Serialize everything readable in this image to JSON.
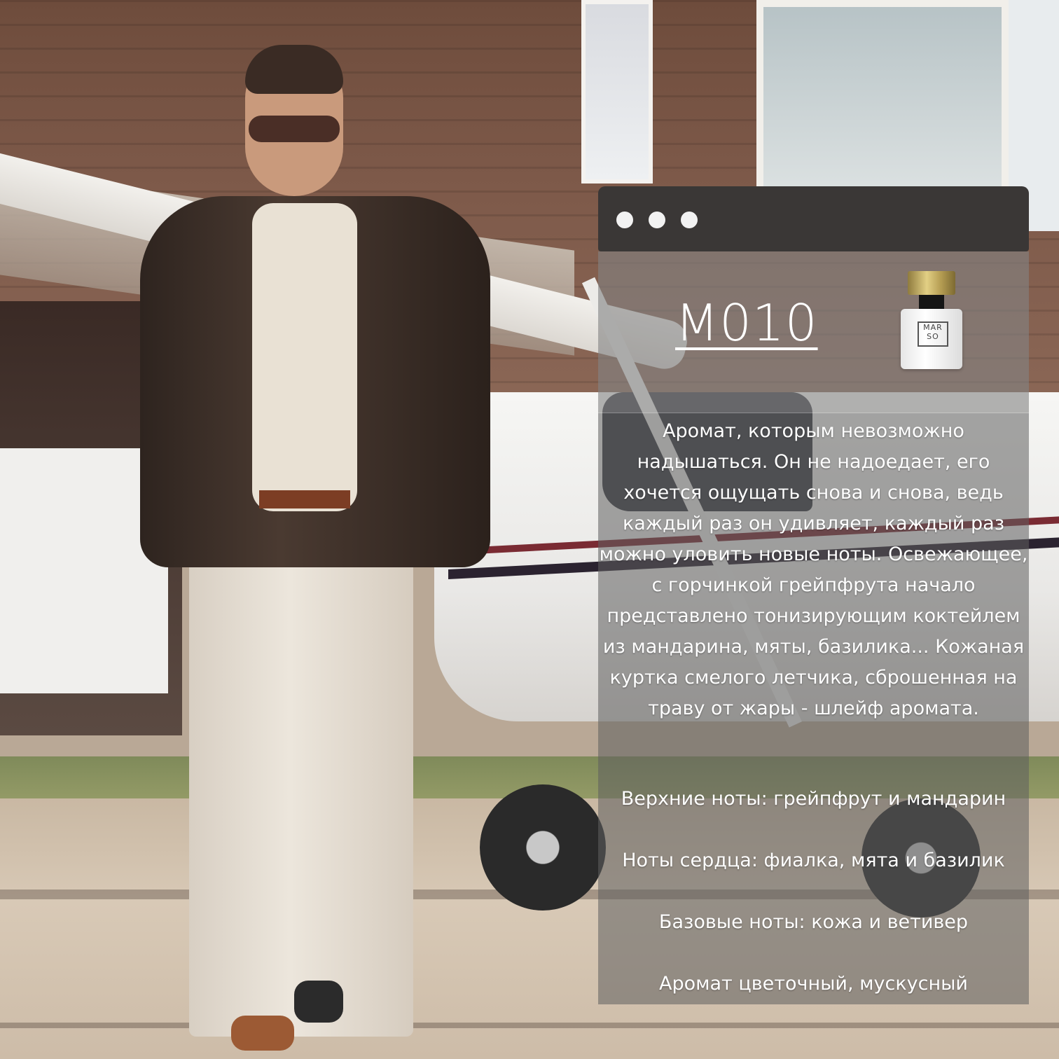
{
  "product": {
    "code": "M010",
    "logo_text": "MAR SO"
  },
  "description": "Аромат, которым невозможно надышаться. Он не надоедает, его хочется ощущать снова и снова, ведь каждый раз он удивляет, каждый раз можно уловить новые ноты. Освежающее, с горчинкой грейпфрута начало представлено тонизирующим коктейлем из мандарина, мяты, базилика... Кожаная куртка смелого летчика, сброшенная на траву от жары - шлейф аромата.",
  "notes": {
    "top": "Верхние ноты: грейпфрут и мандарин",
    "heart": "Ноты сердца: фиалка, мята и базилик",
    "base": "Базовые ноты: кожа и ветивер",
    "character": "Аромат цветочный, мускусный"
  },
  "colors": {
    "bar": "#3a3736",
    "window_dot": "#f2f2f2",
    "text": "#ffffff"
  }
}
